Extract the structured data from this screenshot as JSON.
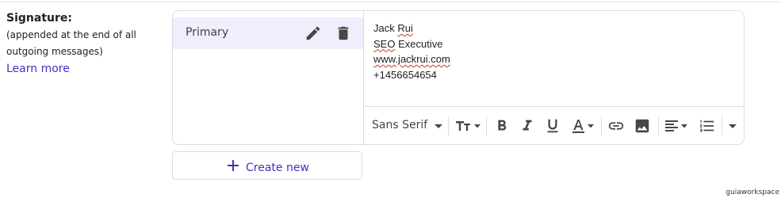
{
  "signature_section": {
    "title": "Signature:",
    "note": "(appended at the end of all outgoing messages)",
    "learn_more": "Learn more"
  },
  "signatures": {
    "items": [
      {
        "label": "Primary",
        "selected": true
      }
    ],
    "edit_icon": "pencil-icon",
    "delete_icon": "trash-icon"
  },
  "editor": {
    "lines": [
      "Jack Rui",
      "SEO Executive",
      "www.jackrui.com",
      "+1456654654"
    ]
  },
  "toolbar": {
    "font_family": "Sans Serif",
    "tools": [
      "font-size-icon",
      "bold-icon",
      "italic-icon",
      "underline-icon",
      "text-color-icon",
      "link-icon",
      "image-icon",
      "align-icon",
      "numbered-list-icon",
      "more-options-icon"
    ]
  },
  "create_new": {
    "label": "Create new"
  },
  "watermark": "guiaworkspace",
  "colors": {
    "accent": "#4a2fbd",
    "selected_bg": "#eeeefc",
    "border": "#dadce0",
    "icon": "#444746",
    "spell_underline": "#d93025"
  }
}
